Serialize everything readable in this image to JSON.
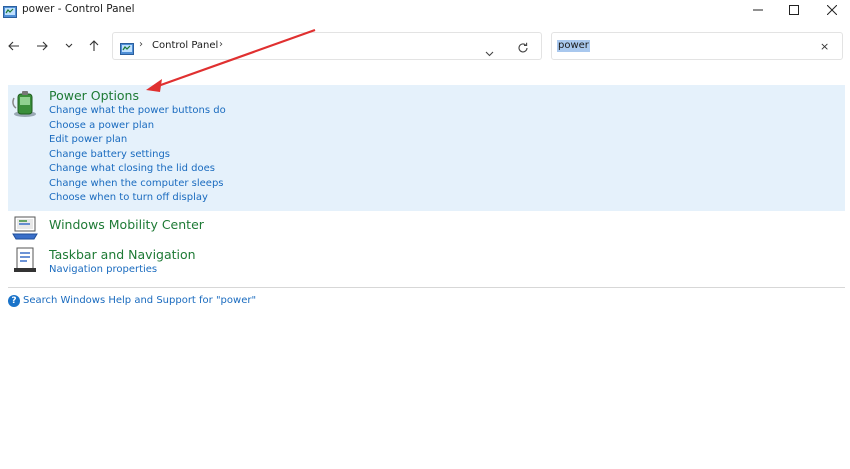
{
  "window": {
    "title": "power - Control Panel"
  },
  "address_bar": {
    "crumb": "Control Panel"
  },
  "search": {
    "value": "power",
    "clear_icon": "×"
  },
  "results": {
    "power_options": {
      "title": "Power Options",
      "tasks": [
        "Change what the power buttons do",
        "Choose a power plan",
        "Edit power plan",
        "Change battery settings",
        "Change what closing the lid does",
        "Change when the computer sleeps",
        "Choose when to turn off display"
      ]
    },
    "mobility_center": {
      "title": "Windows Mobility Center"
    },
    "taskbar_navigation": {
      "title": "Taskbar and Navigation",
      "tasks": [
        "Navigation properties"
      ]
    }
  },
  "help": {
    "icon": "?",
    "link": "Search Windows Help and Support for \"power\""
  },
  "colors": {
    "category_title": "#1e7a35",
    "task_link": "#1a6bbf",
    "highlight_bg": "#e5f1fb",
    "annotation_arrow": "#e03030"
  }
}
